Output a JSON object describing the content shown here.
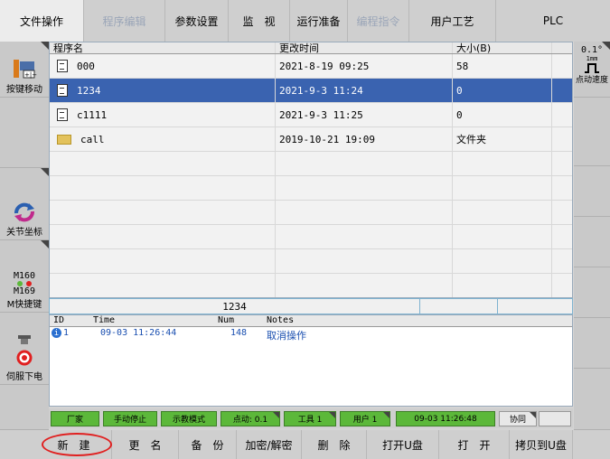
{
  "top_menu": [
    "文件操作",
    "程序编辑",
    "参数设置",
    "监　视",
    "运行准备",
    "编程指令",
    "用户工艺",
    "PLC"
  ],
  "left_side": {
    "jog": "按键移动",
    "coord": "关节坐标",
    "m160": "M160",
    "m169": "M169",
    "quick": "M快捷键",
    "servo": "伺服下电"
  },
  "right_side": {
    "speed_value": "0.1°",
    "speed_unit": "1mm",
    "speed_label": "点动速度"
  },
  "file_table": {
    "headers": [
      "程序名",
      "更改时间",
      "大小(B)"
    ],
    "rows": [
      {
        "name": "000",
        "time": "2021-8-19 09:25",
        "size": "58",
        "type": "file"
      },
      {
        "name": "1234",
        "time": "2021-9-3 11:24",
        "size": "0",
        "type": "file",
        "selected": true
      },
      {
        "name": "c1111",
        "time": "2021-9-3 11:25",
        "size": "0",
        "type": "file"
      },
      {
        "name": "call",
        "time": "2019-10-21 19:09",
        "size": "文件夹",
        "type": "folder"
      }
    ]
  },
  "path_bar": {
    "current": "1234"
  },
  "log_table": {
    "headers": [
      "ID",
      "Time",
      "Num",
      "Notes"
    ],
    "rows": [
      {
        "id": "1",
        "time": "09-03 11:26:44",
        "num": "148",
        "notes": "取消操作"
      }
    ]
  },
  "status_bar": {
    "level": "厂家",
    "run_state": "手动停止",
    "mode": "示教模式",
    "jog_speed": "点动: 0.1",
    "tool": "工具 1",
    "user": "用户 1",
    "datetime": "09-03 11:26:48",
    "collab": "协同"
  },
  "bottom_menu": [
    "新　建",
    "更　名",
    "备　份",
    "加密/解密",
    "删　除",
    "打开U盘",
    "打　开",
    "拷贝到U盘"
  ],
  "colors": {
    "selected_row": "#3a63b0",
    "status_green": "#5cb83a",
    "annotation_red": "#e02020"
  }
}
